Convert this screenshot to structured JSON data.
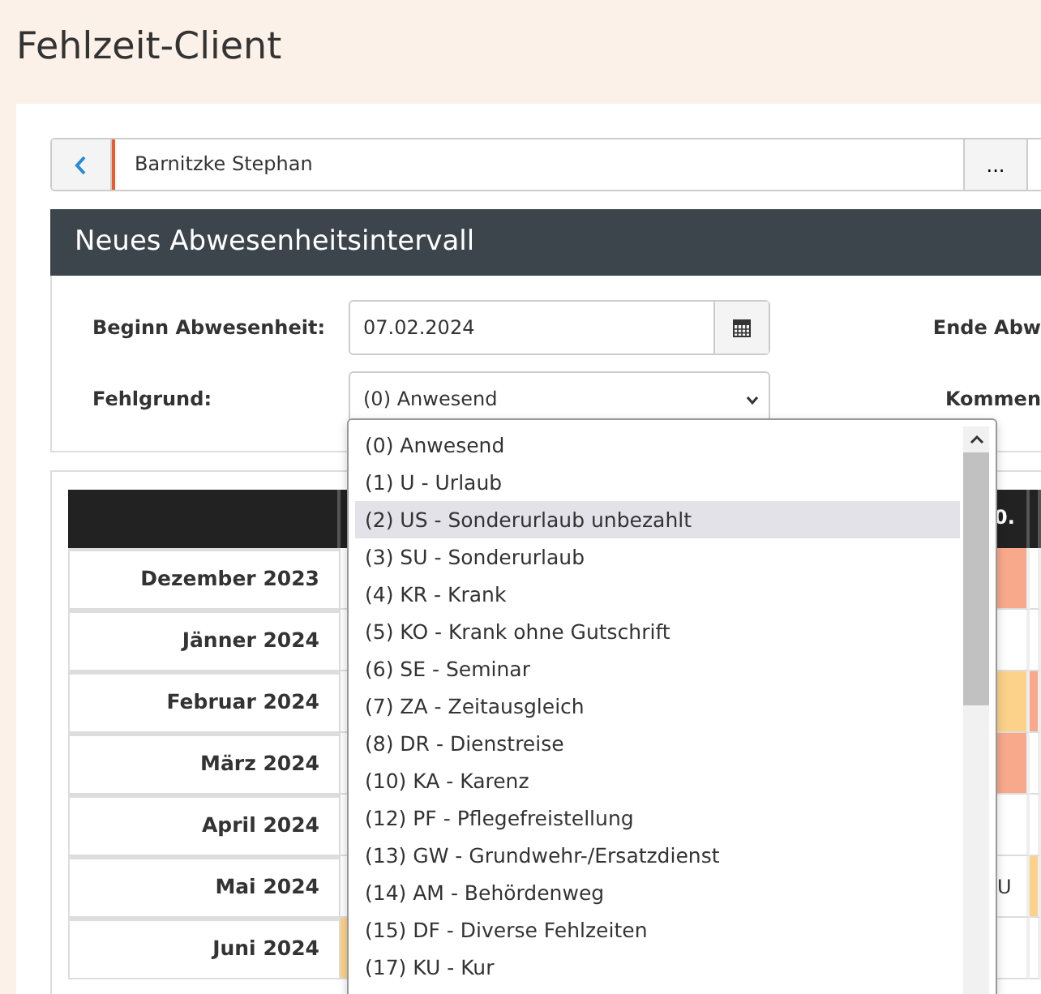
{
  "page_title": "Fehlzeit-Client",
  "employee_bar": {
    "name": "Barnitzke Stephan",
    "more_button": "..."
  },
  "panel": {
    "title": "Neues Abwesenheitsintervall",
    "fields": [
      {
        "label": "Beginn Abwesenheit:",
        "kind": "date",
        "value": "07.02.2024",
        "side_label": "Ende Abw"
      },
      {
        "label": "Fehlgrund:",
        "kind": "select",
        "value": "(0) Anwesend",
        "side_label": "Kommen"
      }
    ]
  },
  "dropdown": {
    "options": [
      {
        "label": "(0) Anwesend",
        "selected": false
      },
      {
        "label": "(1) U - Urlaub",
        "selected": false
      },
      {
        "label": "(2) US - Sonderurlaub unbezahlt",
        "selected": true
      },
      {
        "label": "(3) SU - Sonderurlaub",
        "selected": false
      },
      {
        "label": "(4) KR - Krank",
        "selected": false
      },
      {
        "label": "(5) KO - Krank ohne Gutschrift",
        "selected": false
      },
      {
        "label": "(6) SE - Seminar",
        "selected": false
      },
      {
        "label": "(7) ZA - Zeitausgleich",
        "selected": false
      },
      {
        "label": "(8) DR - Dienstreise",
        "selected": false
      },
      {
        "label": "(10) KA - Karenz",
        "selected": false
      },
      {
        "label": "(12) PF - Pflegefreistellung",
        "selected": false
      },
      {
        "label": "(13) GW - Grundwehr-/Ersatzdienst",
        "selected": false
      },
      {
        "label": "(14) AM - Behördenweg",
        "selected": false
      },
      {
        "label": "(15) DF - Diverse Fehlzeiten",
        "selected": false
      },
      {
        "label": "(17) KU - Kur",
        "selected": false
      }
    ]
  },
  "table": {
    "columns": [
      "",
      "",
      "0."
    ],
    "rows": [
      {
        "month": "Dezember 2023",
        "column_3": {
          "color": "#f9a98b"
        }
      },
      {
        "month": "Jänner 2024"
      },
      {
        "month": "Februar 2024",
        "column_3": {
          "color": "#fcd28a"
        },
        "column_4": {
          "color": "#f9a98b"
        }
      },
      {
        "month": "März 2024",
        "column_3": {
          "color": "#f9a98b"
        }
      },
      {
        "month": "April 2024"
      },
      {
        "month": "Mai 2024",
        "column_3": {
          "value": "U"
        },
        "column_4": {
          "color": "#fcd28a"
        }
      },
      {
        "month": "Juni 2024",
        "column_2": {
          "color": "#fcd28a"
        }
      }
    ]
  }
}
